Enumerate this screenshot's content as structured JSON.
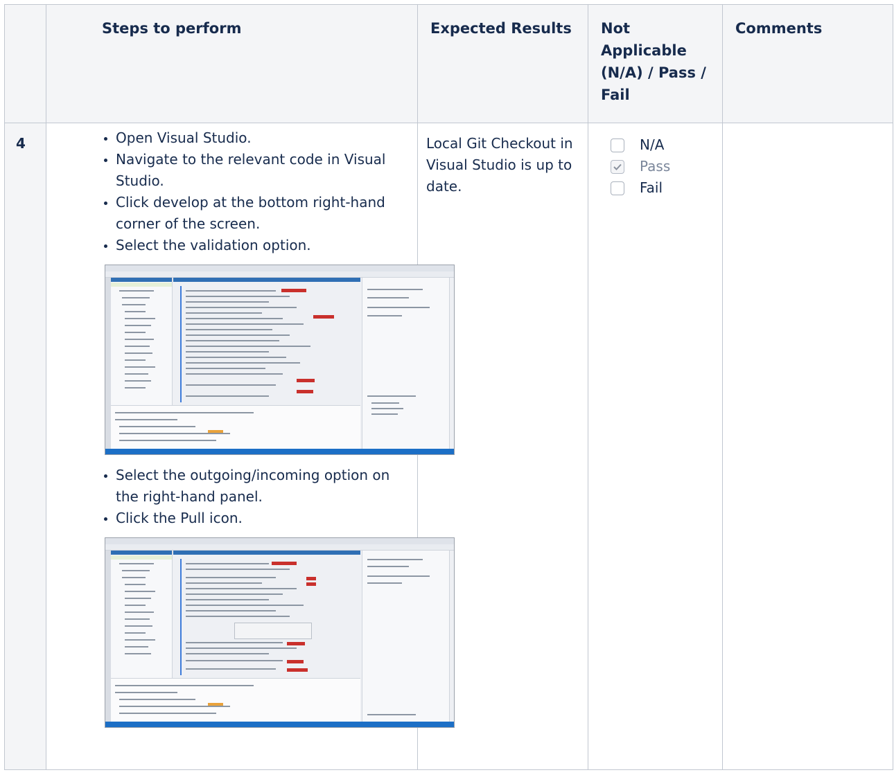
{
  "table": {
    "headers": {
      "num": "",
      "steps": "Steps to perform",
      "expected": "Expected Results",
      "status": "Not Applicable (N/A) / Pass / Fail",
      "comments": "Comments"
    },
    "rows": [
      {
        "number": "4",
        "steps_group1": [
          "Open Visual Studio.",
          "Navigate to the relevant code in Visual Studio.",
          "Click develop at the bottom right-hand corner of the screen.",
          "Select the validation option."
        ],
        "steps_group2": [
          "Select the outgoing/incoming option on the right-hand panel.",
          "Click the Pull icon."
        ],
        "expected": "Local Git Checkout in Visual Studio is up to date.",
        "status_options": [
          {
            "label": "N/A",
            "checked": false
          },
          {
            "label": "Pass",
            "checked": true
          },
          {
            "label": "Fail",
            "checked": false
          }
        ],
        "comments": ""
      }
    ]
  }
}
